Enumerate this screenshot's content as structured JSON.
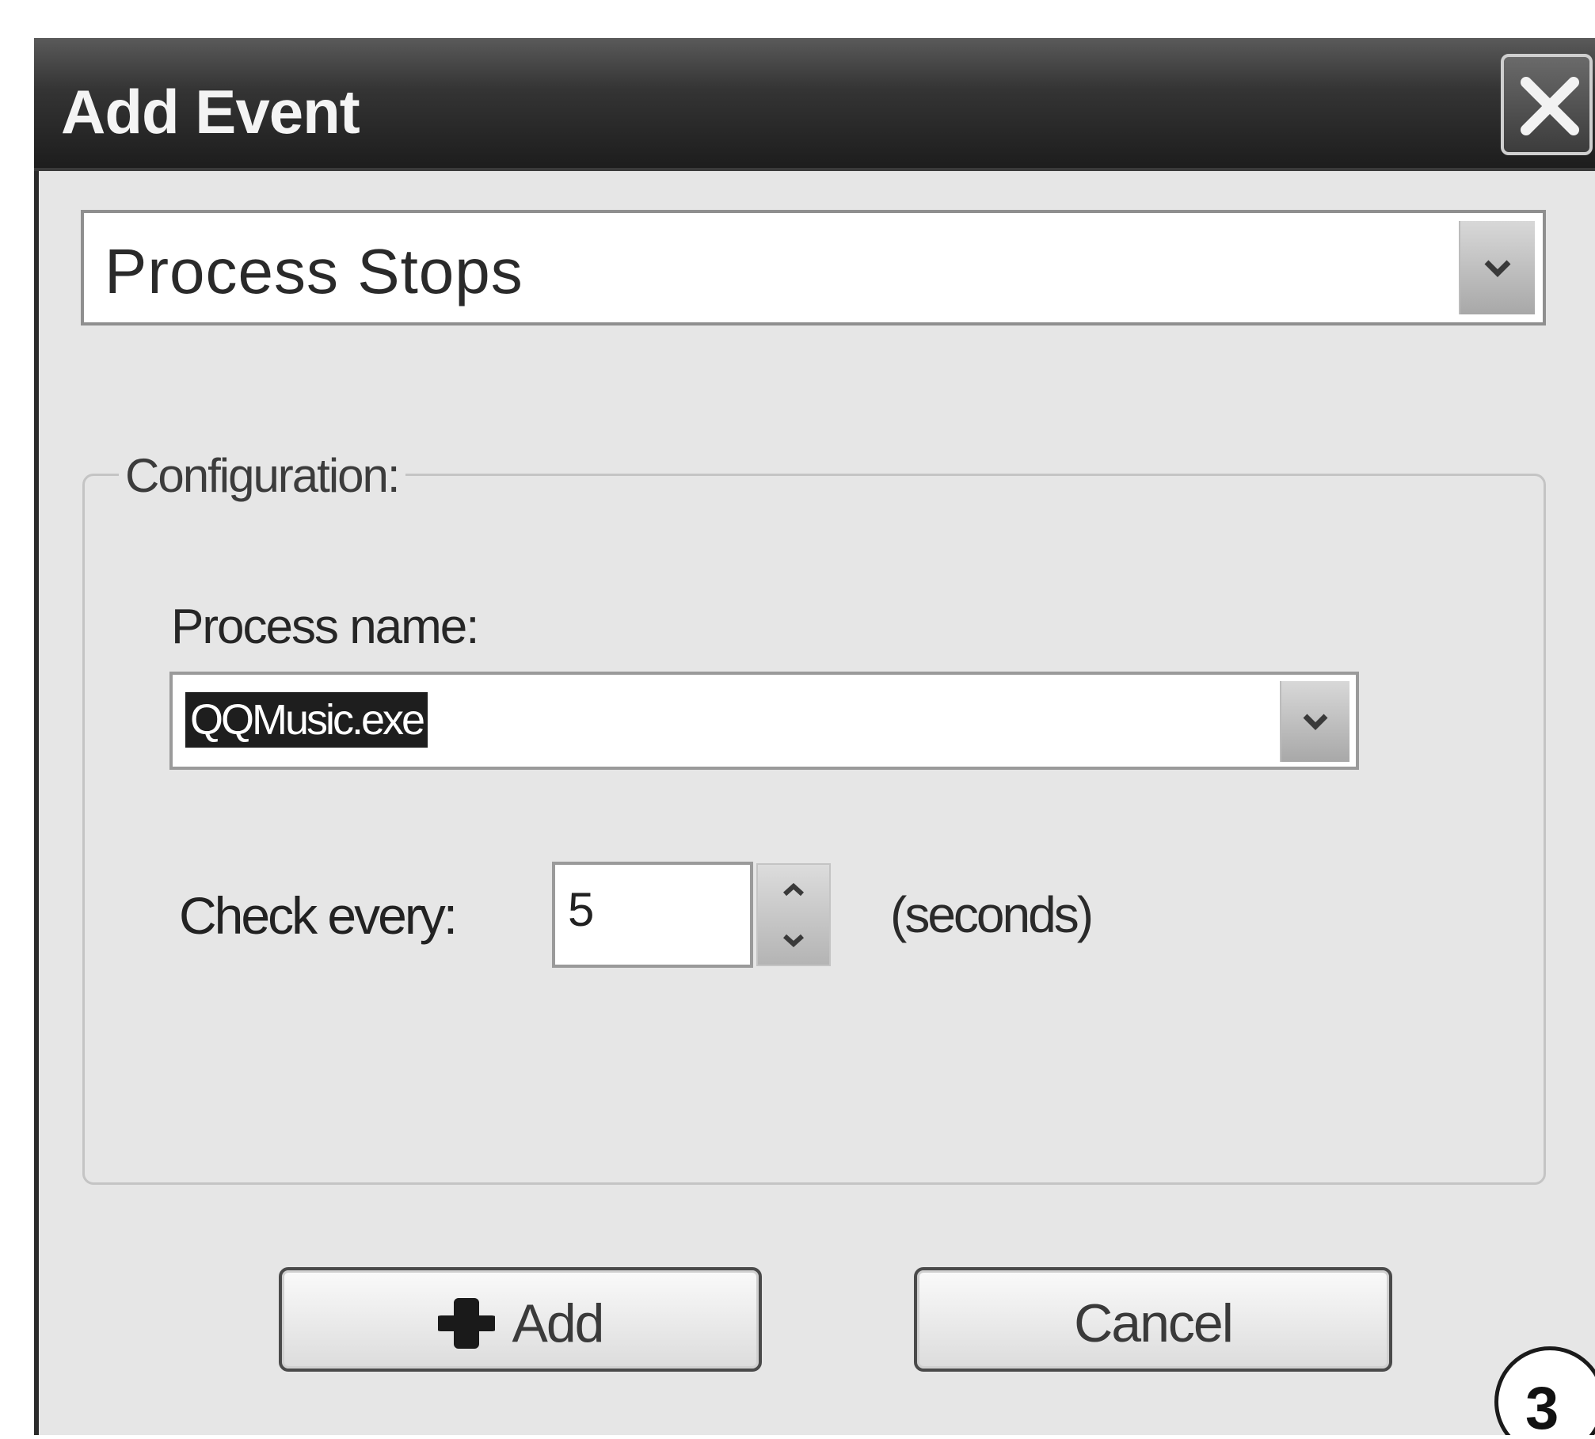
{
  "dialog": {
    "title": "Add Event",
    "close_icon": "close-icon"
  },
  "event_type": {
    "selected": "Process Stops",
    "arrow_icon": "chevron-down-icon"
  },
  "configuration": {
    "group_label": "Configuration:",
    "process_name_label": "Process name:",
    "process_name_value": "QQMusic.exe",
    "check_every_label": "Check every:",
    "check_every_value": "5",
    "units_label": "(seconds)"
  },
  "buttons": {
    "add_label": "Add",
    "add_icon": "plus-icon",
    "cancel_label": "Cancel"
  },
  "step_marker": "3"
}
